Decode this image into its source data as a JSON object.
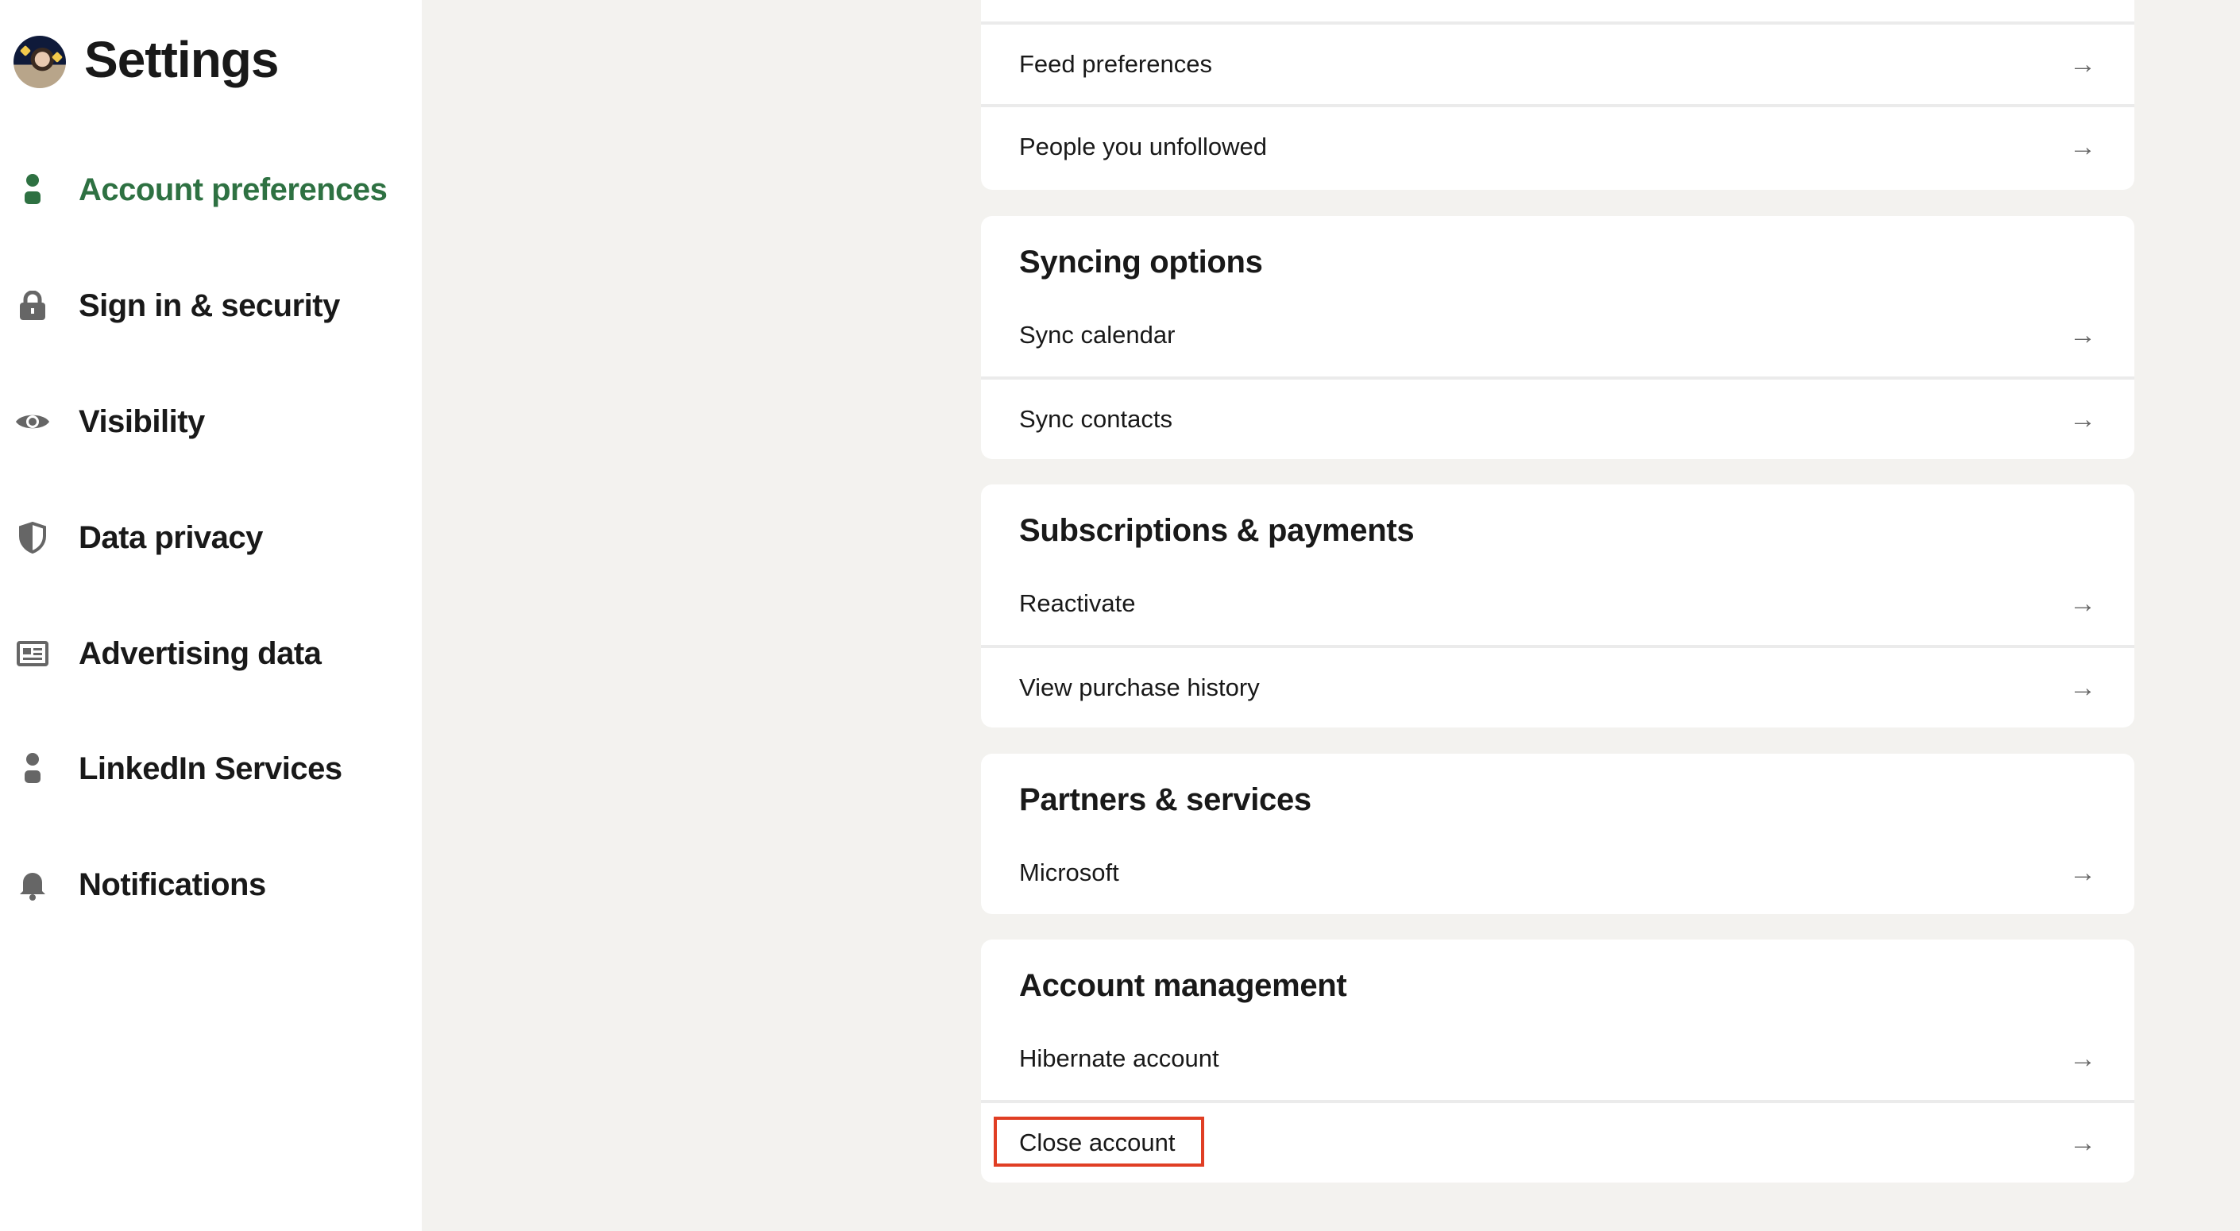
{
  "sidebar": {
    "title": "Settings",
    "accent_color": "#2e7142",
    "items": [
      {
        "label": "Account preferences",
        "icon": "person-icon",
        "active": true
      },
      {
        "label": "Sign in & security",
        "icon": "lock-icon"
      },
      {
        "label": "Visibility",
        "icon": "eye-icon"
      },
      {
        "label": "Data privacy",
        "icon": "shield-icon"
      },
      {
        "label": "Advertising data",
        "icon": "newspaper-icon"
      },
      {
        "label": "LinkedIn Services",
        "icon": "person-icon"
      },
      {
        "label": "Notifications",
        "icon": "bell-icon"
      }
    ]
  },
  "main": {
    "sections": [
      {
        "title": "",
        "rows": [
          "Feed preferences",
          "People you unfollowed"
        ]
      },
      {
        "title": "Syncing options",
        "rows": [
          "Sync calendar",
          "Sync contacts"
        ]
      },
      {
        "title": "Subscriptions & payments",
        "rows": [
          "Reactivate",
          "View purchase history"
        ]
      },
      {
        "title": "Partners & services",
        "rows": [
          "Microsoft"
        ]
      },
      {
        "title": "Account management",
        "rows": [
          "Hibernate account",
          "Close account"
        ]
      }
    ],
    "arrow": "→",
    "highlight_color": "#e03e24"
  }
}
